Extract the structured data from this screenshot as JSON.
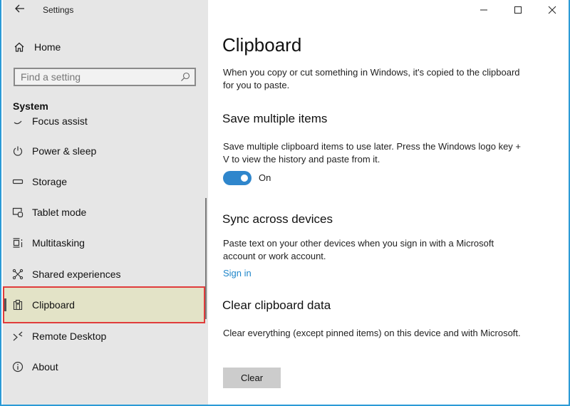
{
  "window": {
    "title": "Settings",
    "back_icon": "back-arrow-icon",
    "caption_buttons": [
      "minimize-icon",
      "maximize-icon",
      "close-icon"
    ]
  },
  "sidebar": {
    "home": {
      "label": "Home",
      "icon": "home-icon"
    },
    "search": {
      "placeholder": "Find a setting",
      "value": "",
      "icon": "search-icon"
    },
    "section": "System",
    "items": [
      {
        "label": "Focus assist",
        "icon": "moon-icon",
        "active": false
      },
      {
        "label": "Power & sleep",
        "icon": "power-icon",
        "active": false
      },
      {
        "label": "Storage",
        "icon": "storage-icon",
        "active": false
      },
      {
        "label": "Tablet mode",
        "icon": "tablet-mode-icon",
        "active": false
      },
      {
        "label": "Multitasking",
        "icon": "multitasking-icon",
        "active": false
      },
      {
        "label": "Shared experiences",
        "icon": "shared-experiences-icon",
        "active": false
      },
      {
        "label": "Clipboard",
        "icon": "clipboard-icon",
        "active": true
      },
      {
        "label": "Remote Desktop",
        "icon": "remote-desktop-icon",
        "active": false
      },
      {
        "label": "About",
        "icon": "info-icon",
        "active": false
      }
    ]
  },
  "main": {
    "title": "Clipboard",
    "intro": "When you copy or cut something in Windows, it's copied to the clipboard for you to paste.",
    "save_multiple": {
      "heading": "Save multiple items",
      "description": "Save multiple clipboard items to use later. Press the Windows logo key + V to view the history and paste from it.",
      "toggle_state": true,
      "toggle_label": "On"
    },
    "sync": {
      "heading": "Sync across devices",
      "description": "Paste text on your other devices when you sign in with a Microsoft account or work account.",
      "link": "Sign in"
    },
    "clear": {
      "heading": "Clear clipboard data",
      "description": "Clear everything (except pinned items) on this device and with Microsoft.",
      "button": "Clear"
    }
  },
  "colors": {
    "accent": "#2f86cc",
    "link": "#1f86c9",
    "highlight_border": "#e03c3c",
    "active_bg": "#e3e3c7",
    "sidebar_bg": "#e6e6e6"
  }
}
